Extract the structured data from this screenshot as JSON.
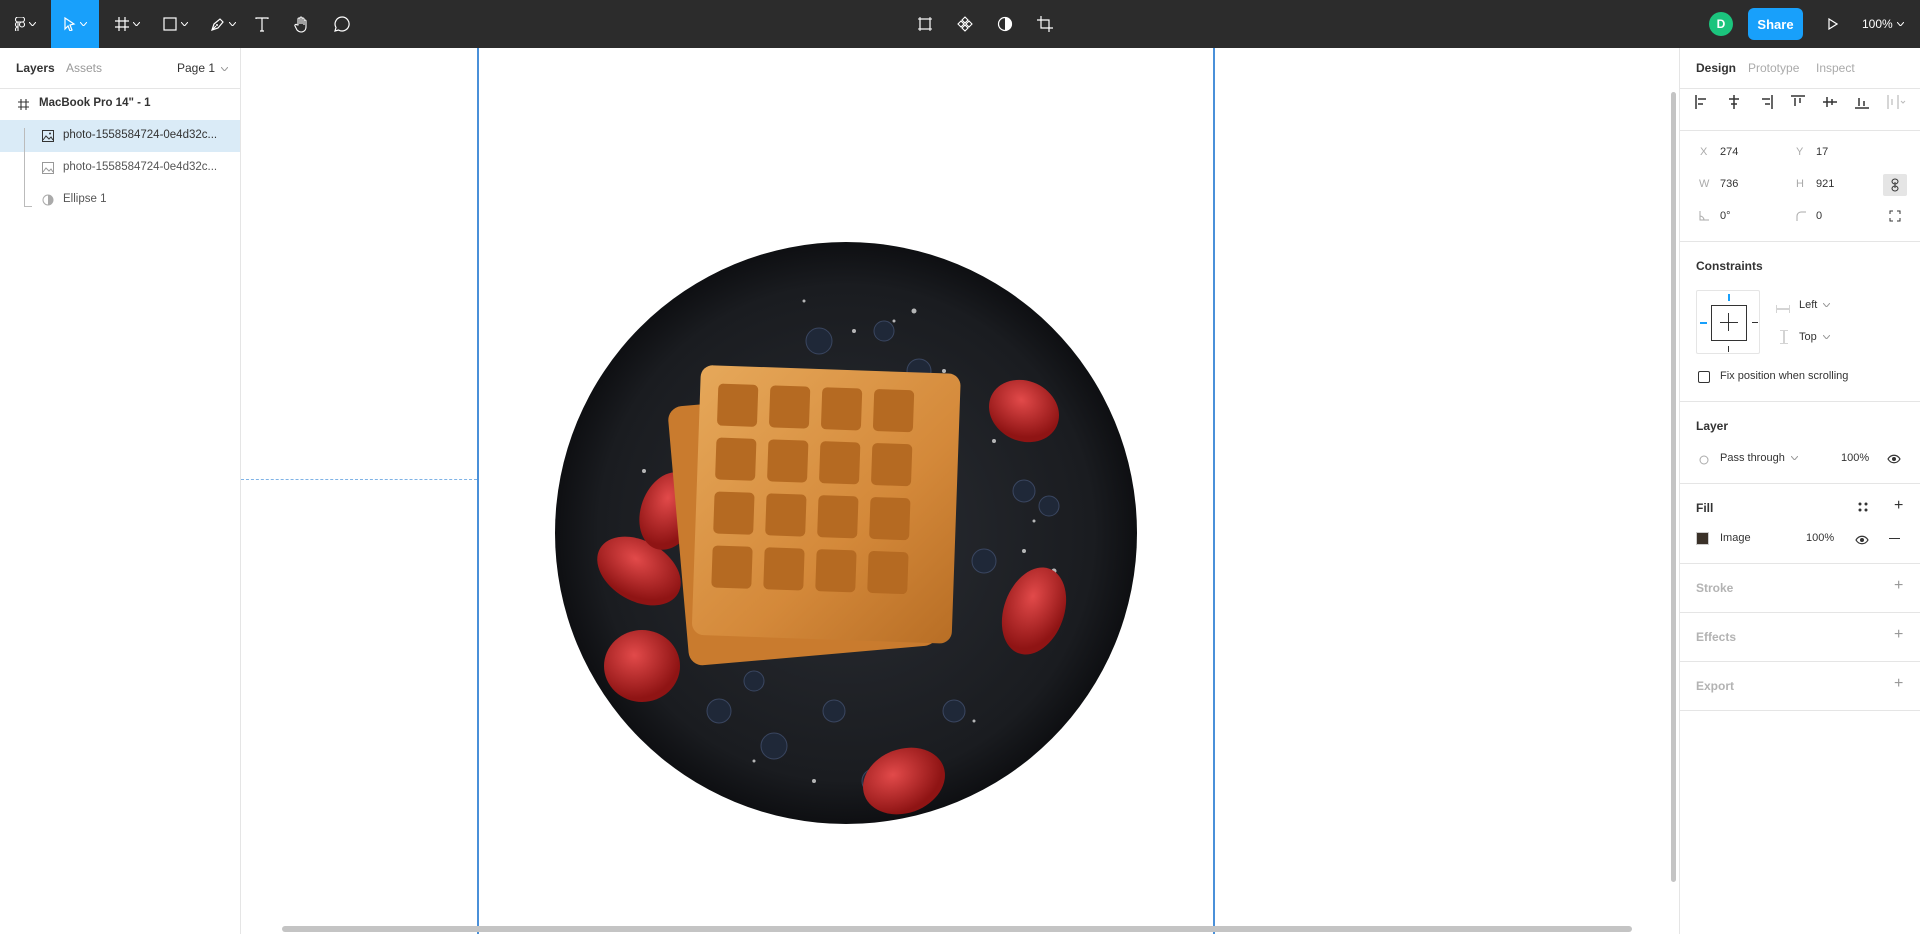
{
  "toolbar": {
    "avatar_initial": "D",
    "share_label": "Share",
    "zoom_label": "100%"
  },
  "left_panel": {
    "tabs": [
      "Layers",
      "Assets"
    ],
    "page_label": "Page 1",
    "frame_label": "MacBook Pro 14\" - 1",
    "layers": [
      {
        "label": "photo-1558584724-0e4d32c...",
        "selected": true
      },
      {
        "label": "photo-1558584724-0e4d32c...",
        "selected": false
      },
      {
        "label": "Ellipse 1",
        "selected": false
      }
    ]
  },
  "right_panel": {
    "tabs": [
      "Design",
      "Prototype",
      "Inspect"
    ],
    "props": {
      "x_label": "X",
      "x": "274",
      "y_label": "Y",
      "y": "17",
      "w_label": "W",
      "w": "736",
      "h_label": "H",
      "h": "921",
      "rotation": "0°",
      "radius": "0"
    },
    "constraints_title": "Constraints",
    "constraint_h": "Left",
    "constraint_v": "Top",
    "fix_scroll_label": "Fix position when scrolling",
    "layer_title": "Layer",
    "blend_mode": "Pass through",
    "layer_opacity": "100%",
    "fill_title": "Fill",
    "fill_type": "Image",
    "fill_opacity": "100%",
    "stroke_title": "Stroke",
    "effects_title": "Effects",
    "export_title": "Export"
  },
  "colors": {
    "toolbar_bg": "#2c2c2c",
    "accent": "#18a0fb",
    "avatar": "#1bc47d",
    "selection": "#daebf7",
    "frame_border": "#4a90d9"
  }
}
